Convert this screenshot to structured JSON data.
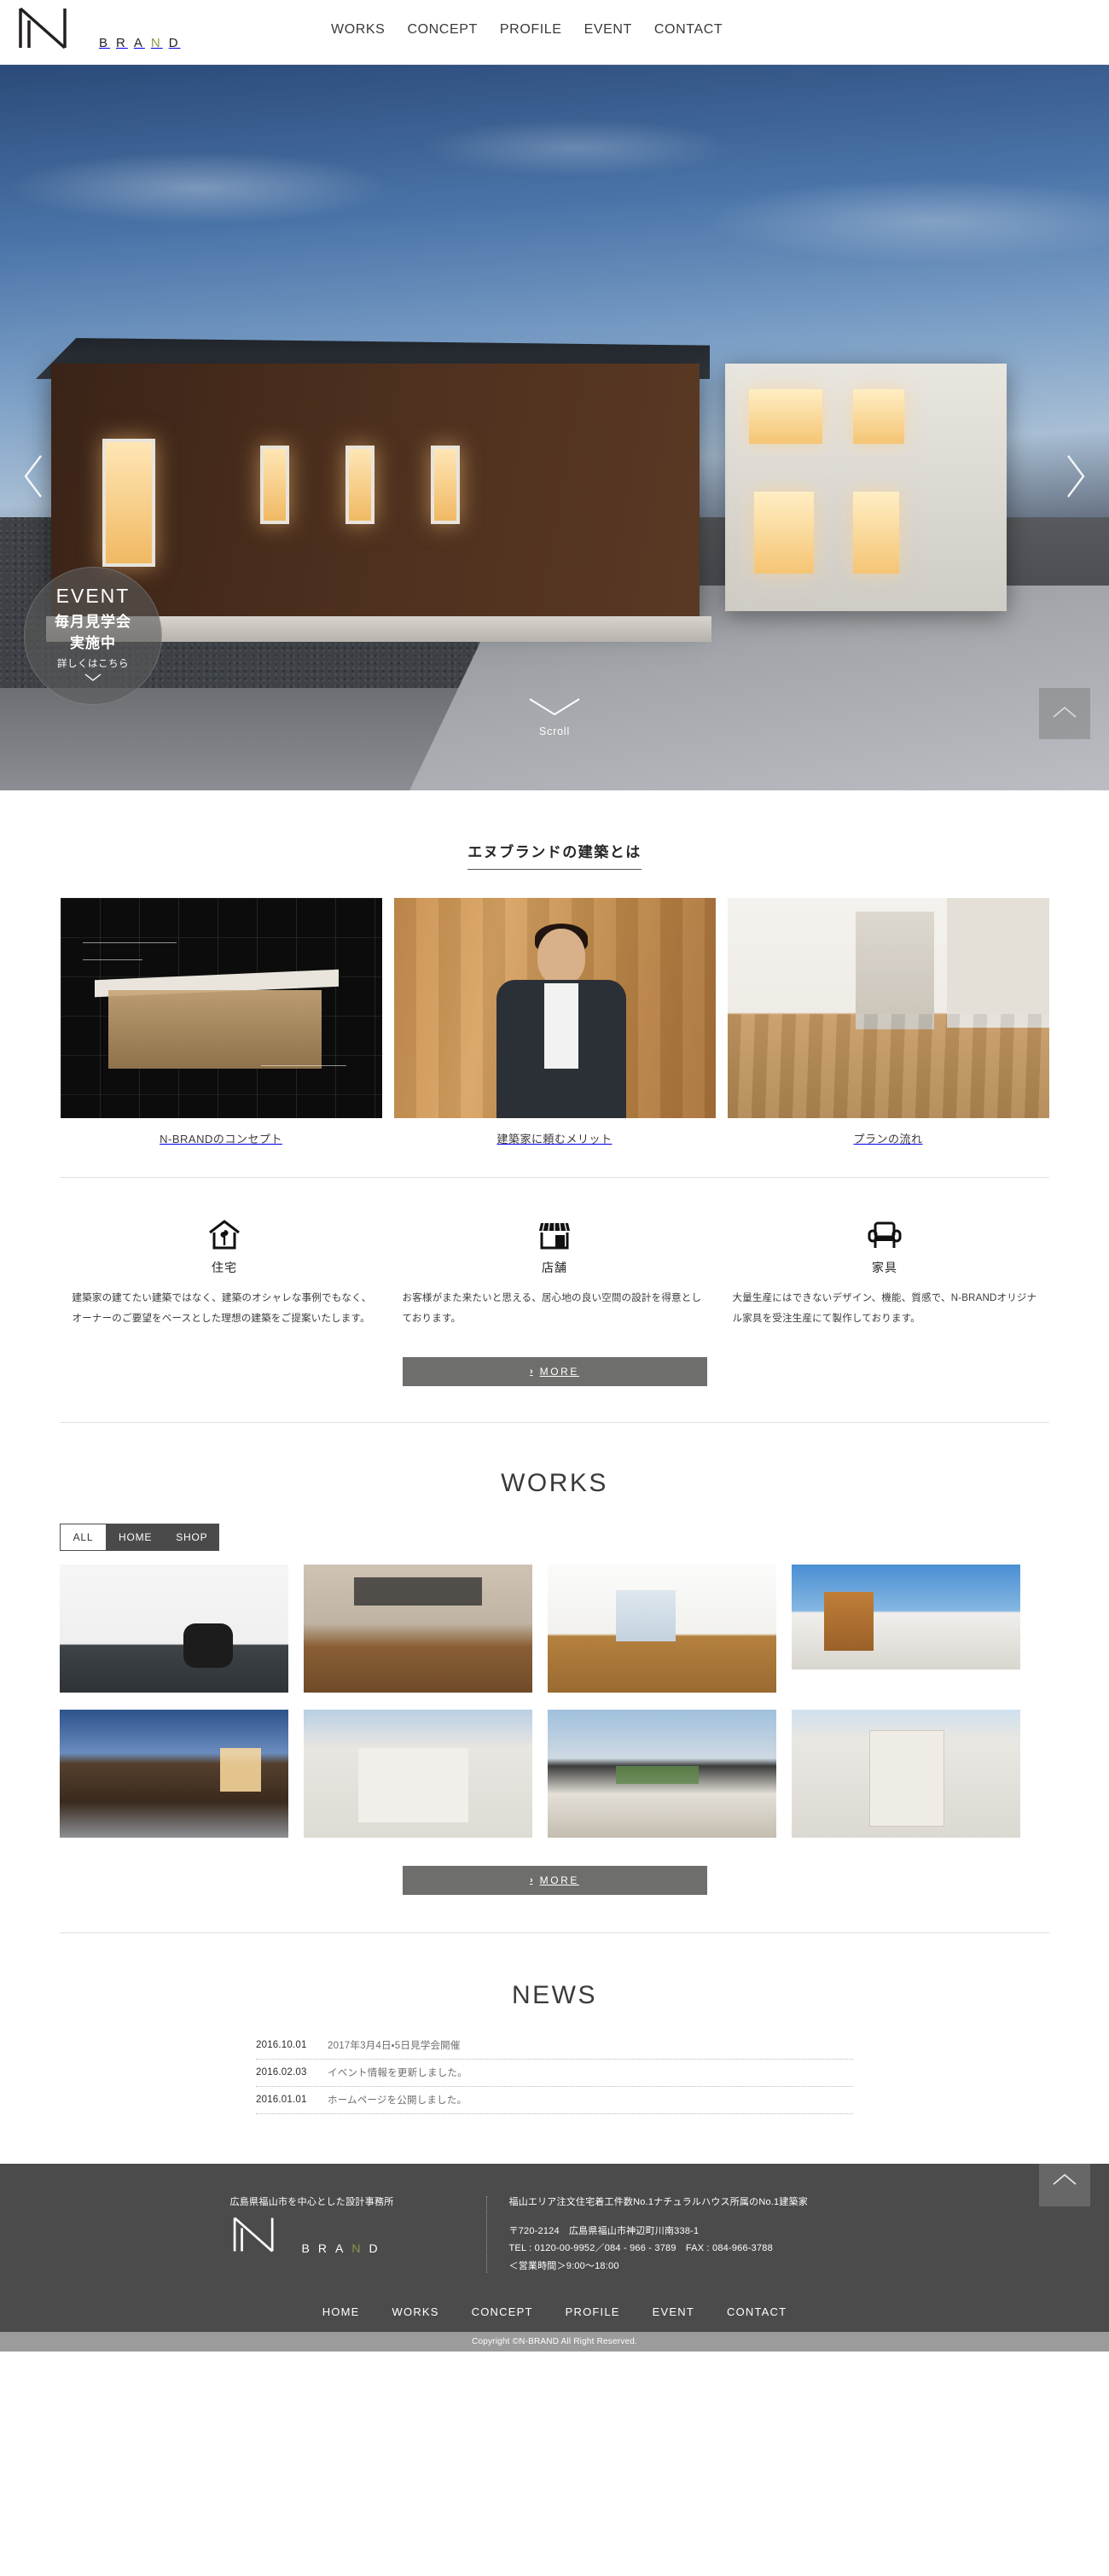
{
  "brand": {
    "name": "N-BRAND",
    "wordmark": [
      "B",
      "R",
      "A",
      "N",
      "D"
    ],
    "olive_letter_index": 3,
    "olive_color": "#8a9a45"
  },
  "header": {
    "nav": [
      {
        "label": "WORKS"
      },
      {
        "label": "CONCEPT"
      },
      {
        "label": "PROFILE"
      },
      {
        "label": "EVENT"
      },
      {
        "label": "CONTACT"
      }
    ]
  },
  "hero": {
    "prev_arrow": "chevron-left",
    "next_arrow": "chevron-right",
    "event_badge": {
      "title": "EVENT",
      "line1": "毎月見学会",
      "line2": "実施中",
      "link": "詳しくはこちら"
    },
    "scroll_label": "Scroll",
    "to_top_label": "page-top"
  },
  "concept": {
    "title": "エヌブランドの建築とは",
    "cards": [
      {
        "caption": "N-BRANDのコンセプト",
        "image": "blueprint-sketch"
      },
      {
        "caption": "建築家に頼むメリット",
        "image": "architect-portrait"
      },
      {
        "caption": "プランの流れ",
        "image": "interior-hallway"
      }
    ],
    "features": [
      {
        "icon": "house-plant-icon",
        "label": "住宅",
        "text": "建築家の建てたい建築ではなく、建築のオシャレな事例でもなく、オーナーのご要望をベースとした理想の建築をご提案いたします。"
      },
      {
        "icon": "storefront-icon",
        "label": "店舗",
        "text": "お客様がまた来たいと思える、居心地の良い空間の設計を得意としております。"
      },
      {
        "icon": "armchair-icon",
        "label": "家具",
        "text": "大量生産にはできないデザイン、機能、質感で、N-BRANDオリジナル家具を受注生産にて製作しております。"
      }
    ],
    "more_button": "MORE",
    "more_chevron": "›"
  },
  "works": {
    "title": "WORKS",
    "tabs": [
      {
        "label": "ALL",
        "active": true
      },
      {
        "label": "HOME",
        "active": false
      },
      {
        "label": "SHOP",
        "active": false
      }
    ],
    "items": [
      {
        "image": "salon-interior"
      },
      {
        "image": "loft-living-stairs"
      },
      {
        "image": "white-living-room"
      },
      {
        "image": "two-story-duplex"
      },
      {
        "image": "dusk-wooden-house"
      },
      {
        "image": "white-modern-house"
      },
      {
        "image": "natural-house-shop"
      },
      {
        "image": "narrow-gable-house"
      }
    ],
    "more_button": "MORE",
    "more_chevron": "›"
  },
  "news": {
    "title": "NEWS",
    "items": [
      {
        "date": "2016.10.01",
        "text": "2017年3月4日・5日見学会開催"
      },
      {
        "date": "2016.02.03",
        "text": "イベント情報を更新しました。"
      },
      {
        "date": "2016.01.01",
        "text": "ホームページを公開しました。"
      }
    ]
  },
  "footer": {
    "tagline": "広島県福山市を中心とした設計事務所",
    "headline": "福山エリア注文住宅着工件数No.1ナチュラルハウス所属のNo.1建築家",
    "address": "〒720-2124　広島県福山市神辺町川南338-1",
    "tel_fax": "TEL : 0120-00-9952／084 - 966 - 3789　FAX : 084-966-3788",
    "hours": "＜営業時間＞9:00～18:00",
    "nav": [
      {
        "label": "HOME"
      },
      {
        "label": "WORKS"
      },
      {
        "label": "CONCEPT"
      },
      {
        "label": "PROFILE"
      },
      {
        "label": "EVENT"
      },
      {
        "label": "CONTACT"
      }
    ],
    "copyright": "Copyright ©N-BRAND All Right Reserved."
  }
}
